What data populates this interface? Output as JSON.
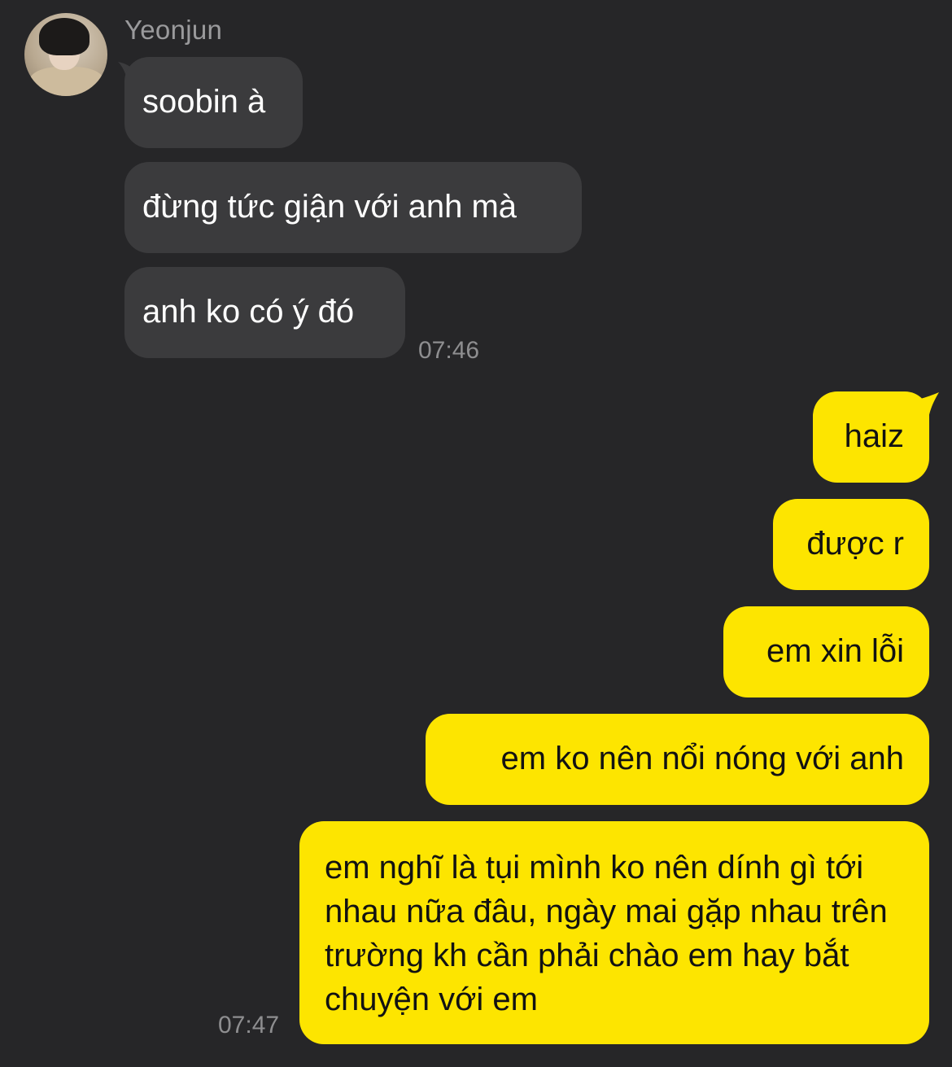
{
  "contact": {
    "name": "Yeonjun"
  },
  "incoming": {
    "messages": [
      "soobin à",
      "đừng tức giận với anh mà",
      "anh ko có ý đó"
    ],
    "time": "07:46"
  },
  "outgoing": {
    "messages": [
      "haiz",
      "được r",
      "em xin lỗi",
      "em ko nên nổi nóng với anh",
      "em nghĩ là tụi mình ko nên dính gì tới nhau nữa đâu, ngày mai gặp nhau trên trường kh cần phải chào em hay bắt chuyện với em"
    ],
    "time": "07:47"
  },
  "colors": {
    "background": "#262628",
    "incoming_bubble": "#3b3b3d",
    "outgoing_bubble": "#fde500",
    "timestamp": "#8e8e90"
  },
  "icons": {
    "avatar": "contact-photo"
  }
}
